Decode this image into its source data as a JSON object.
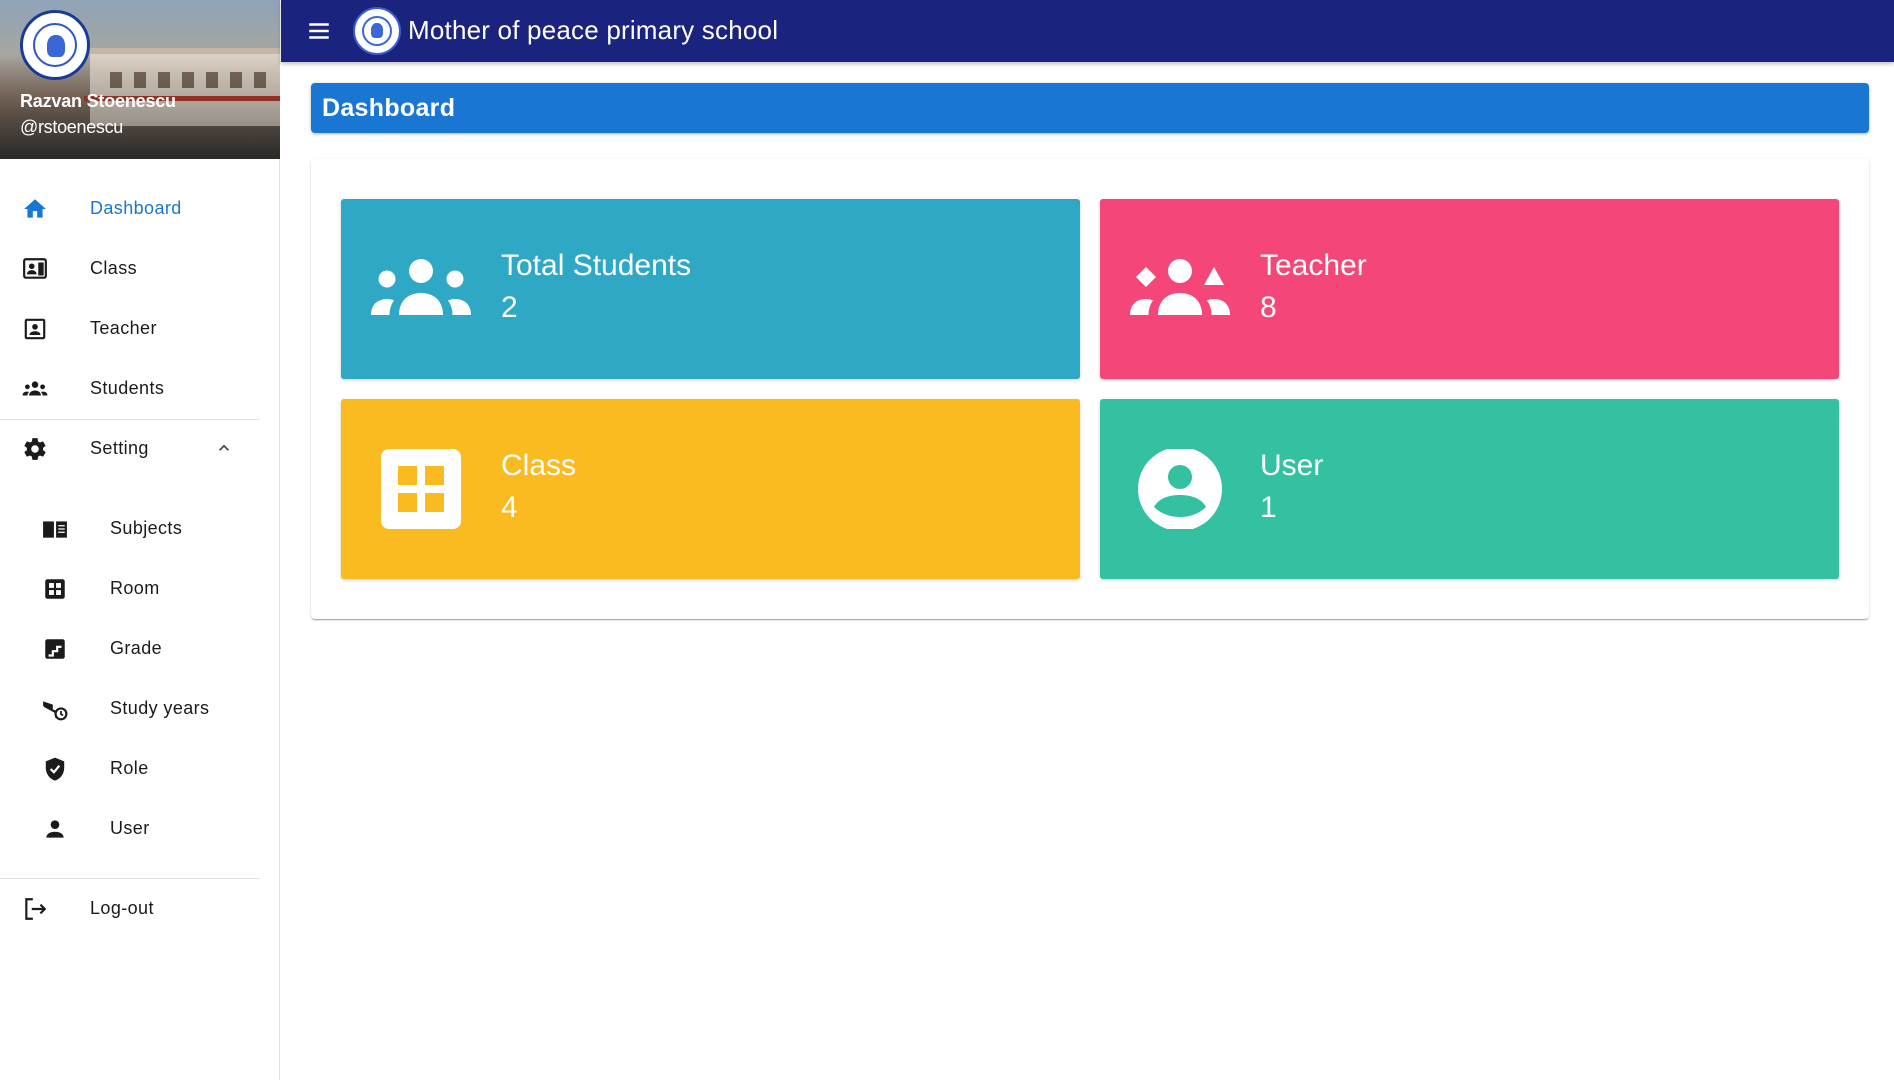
{
  "app": {
    "title": "Mother of peace primary school"
  },
  "profile": {
    "name": "Razvan Stoenescu",
    "handle": "@rstoenescu"
  },
  "sidebar": {
    "items": [
      {
        "label": "Dashboard",
        "icon": "home-icon",
        "active": true
      },
      {
        "label": "Class",
        "icon": "class-badge-icon"
      },
      {
        "label": "Teacher",
        "icon": "contact-card-icon"
      },
      {
        "label": "Students",
        "icon": "group-icon"
      },
      {
        "label": "Setting",
        "icon": "gear-icon",
        "expanded": true
      }
    ],
    "sub_items": [
      {
        "label": "Subjects",
        "icon": "book-icon"
      },
      {
        "label": "Room",
        "icon": "grid-icon"
      },
      {
        "label": "Grade",
        "icon": "stairs-icon"
      },
      {
        "label": "Study years",
        "icon": "schedule-icon"
      },
      {
        "label": "Role",
        "icon": "shield-icon"
      },
      {
        "label": "User",
        "icon": "person-icon"
      }
    ],
    "logout": {
      "label": "Log-out",
      "icon": "logout-icon"
    }
  },
  "main": {
    "header": "Dashboard",
    "stats": [
      {
        "title": "Total Students",
        "count": "2",
        "color": "#2ea8c5",
        "icon": "groups-icon"
      },
      {
        "title": "Teacher",
        "count": "8",
        "color": "#f44678",
        "icon": "diversity-icon"
      },
      {
        "title": "Class",
        "count": "4",
        "color": "#f9bb1f",
        "icon": "grid-icon"
      },
      {
        "title": "User",
        "count": "1",
        "color": "#33c1a2",
        "icon": "account-circle-icon"
      }
    ]
  },
  "colors": {
    "appbar": "#1a237e",
    "accent": "#1976d2"
  }
}
